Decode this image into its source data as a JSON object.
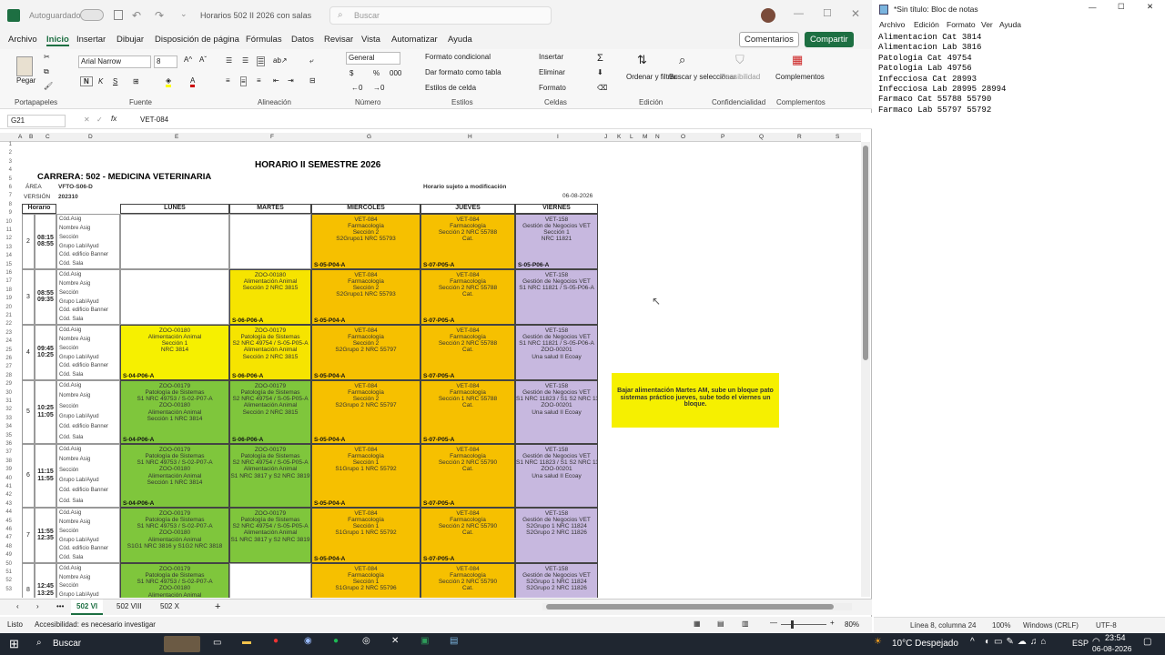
{
  "excel": {
    "autosave_label": "Autoguardado",
    "doc_title": "Horarios 502 II 2026 con salas",
    "search_placeholder": "Buscar",
    "menu": [
      "Archivo",
      "Inicio",
      "Insertar",
      "Dibujar",
      "Disposición de página",
      "Fórmulas",
      "Datos",
      "Revisar",
      "Vista",
      "Automatizar",
      "Ayuda"
    ],
    "comments_btn": "Comentarios",
    "share_btn": "Compartir",
    "ribbon": {
      "paste": "Pegar",
      "font_name": "Arial Narrow",
      "font_size": "8",
      "number_format": "General",
      "cond_format": "Formato condicional",
      "table_format": "Dar formato como tabla",
      "cell_styles": "Estilos de celda",
      "insert": "Insertar",
      "delete": "Eliminar",
      "format": "Formato",
      "sort_filter": "Ordenar y filtrar",
      "find_select": "Buscar y seleccionar",
      "sensitivity": "Sensibilidad",
      "addins": "Complementos",
      "groups": [
        "Portapapeles",
        "Fuente",
        "Alineación",
        "Número",
        "Estilos",
        "Celdas",
        "Edición",
        "Confidencialidad",
        "Complementos"
      ]
    },
    "namebox": "G21",
    "formula": "VET-084",
    "columns": [
      "A",
      "B",
      "C",
      "D",
      "E",
      "F",
      "G",
      "H",
      "I",
      "J",
      "K",
      "L",
      "M",
      "N",
      "O",
      "P",
      "Q",
      "R",
      "S"
    ],
    "sheet": {
      "title": "HORARIO II SEMESTRE 2026",
      "carrera": "CARRERA: 502 - MEDICINA VETERINARIA",
      "area_label": "ÁREA",
      "area_value": "VFTO-S06-D",
      "version_label": "VERSIÓN",
      "version_value": "202310",
      "subject_note": "Horario sujeto a modificación",
      "date": "06-08-2026",
      "headers": [
        "Horario",
        "LUNES",
        "MARTES",
        "MIÉRCOLES",
        "JUEVES",
        "VIERNES"
      ],
      "row_labels": [
        "Cód.Asig",
        "Nombre Asig",
        "Sección",
        "Grupo Lab/Ayud",
        "Cód. edificio Banner",
        "Cód. Sala"
      ],
      "blocks": [
        {
          "n": "2",
          "time": "08:15\n08:55",
          "cells": [
            {
              "day": 3,
              "color": "#f6c000",
              "text": "VET-084\nFarmacología\nSección 2\nS2Grupo1 NRC 55793",
              "room": "S-05-P04-A"
            },
            {
              "day": 4,
              "color": "#f6c000",
              "text": "VET-084\nFarmacología\nSección 2 NRC 55788\nCat.",
              "room": "S-07-P05-A"
            },
            {
              "day": 5,
              "color": "#c7b8df",
              "text": "VET-158\nGestión de Negocios VET\nSección 1\nNRC 11821",
              "room": "S-05-P06-A"
            }
          ]
        },
        {
          "n": "3",
          "time": "08:55\n09:35",
          "cells": [
            {
              "day": 2,
              "color": "#f6e400",
              "text": "ZOO-00180\nAlimentación Animal\nSección 2 NRC 3815",
              "room": "S-06-P06-A"
            },
            {
              "day": 3,
              "color": "#f6c000",
              "text": "VET-084\nFarmacología\nSección 2\nS2Grupo1 NRC 55793",
              "room": "S-05-P04-A"
            },
            {
              "day": 4,
              "color": "#f6c000",
              "text": "VET-084\nFarmacología\nSección 2 NRC 55788\nCat.",
              "room": "S-07-P05-A"
            },
            {
              "day": 5,
              "color": "#c7b8df",
              "text": "VET-158\nGestión de Negocios VET\nS1 NRC 11821 / S-05-P06-A",
              "room": ""
            }
          ]
        },
        {
          "n": "4",
          "time": "09:45\n10:25",
          "cells": [
            {
              "day": 1,
              "color": "#f6f000",
              "text": "ZOO-00180\nAlimentación Animal\nSección 1\nNRC 3814",
              "room": "S-04-P06-A"
            },
            {
              "day": 2,
              "color": "#f6e400",
              "text": "ZOO-00179\nPatología de Sistemas\nS2 NRC 49754 / S-05-P05-A\nAlimentación Animal\nSección 2 NRC 3815",
              "room": "S-06-P06-A"
            },
            {
              "day": 3,
              "color": "#f6c000",
              "text": "VET-084\nFarmacología\nSección 2\nS2Grupo 2 NRC 55797",
              "room": "S-05-P04-A"
            },
            {
              "day": 4,
              "color": "#f6c000",
              "text": "VET-084\nFarmacología\nSección 2 NRC 55788\nCat.",
              "room": "S-07-P05-A"
            },
            {
              "day": 5,
              "color": "#c7b8df",
              "text": "VET-158\nGestión de Negocios VET\nS1 NRC 11821 / S-05-P06-A\nZOO-00201\nUna salud II Ecoay",
              "room": ""
            }
          ]
        },
        {
          "n": "5",
          "time": "10:25\n11:05",
          "cells": [
            {
              "day": 1,
              "color": "#7fc63c",
              "text": "ZOO-00179\nPatología de Sistemas\nS1 NRC 49753 / S-02-P07-A\nZOO-00180\nAlimentación Animal\nSección 1 NRC 3814",
              "room": "S-04-P06-A"
            },
            {
              "day": 2,
              "color": "#7fc63c",
              "text": "ZOO-00179\nPatología de Sistemas\nS2 NRC 49754 / S-05-P05-A\nAlimentación Animal\nSección 2 NRC 3815",
              "room": "S-06-P06-A"
            },
            {
              "day": 3,
              "color": "#f6c000",
              "text": "VET-084\nFarmacología\nSección 2\nS2Grupo 2 NRC 55797",
              "room": "S-05-P04-A"
            },
            {
              "day": 4,
              "color": "#f6c000",
              "text": "VET-084\nFarmacología\nSección 1 NRC 55788\nCat.",
              "room": "S-07-P05-A"
            },
            {
              "day": 5,
              "color": "#c7b8df",
              "text": "VET-158\nGestión de Negocios VET\nS1 NRC 11823 / S1 S2 NRC 11825\nZOO-00201\nUna salud II Ecoay",
              "room": ""
            }
          ]
        },
        {
          "n": "6",
          "time": "11:15\n11:55",
          "cells": [
            {
              "day": 1,
              "color": "#7fc63c",
              "text": "ZOO-00179\nPatología de Sistemas\nS1 NRC 49753 / S-02-P07-A\nZOO-00180\nAlimentación Animal\nSección 1 NRC 3814",
              "room": "S-04-P06-A"
            },
            {
              "day": 2,
              "color": "#7fc63c",
              "text": "ZOO-00179\nPatología de Sistemas\nS2 NRC 49754 / S-05-P05-A\nAlimentación Animal\nS1 NRC 3817 y S2 NRC 3819",
              "room": ""
            },
            {
              "day": 3,
              "color": "#f6c000",
              "text": "VET-084\nFarmacología\nSección 1\nS1Grupo 1 NRC 55792",
              "room": "S-05-P04-A"
            },
            {
              "day": 4,
              "color": "#f6c000",
              "text": "VET-084\nFarmacología\nSección 2 NRC 55790\nCat.",
              "room": "S-07-P05-A"
            },
            {
              "day": 5,
              "color": "#c7b8df",
              "text": "VET-158\nGestión de Negocios VET\nS1 NRC 11823 / S1 S2 NRC 11825\nZOO-00201\nUna salud II Ecoay",
              "room": ""
            }
          ]
        },
        {
          "n": "7",
          "time": "11:55\n12:35",
          "cells": [
            {
              "day": 1,
              "color": "#7fc63c",
              "text": "ZOO-00179\nPatología de Sistemas\nS1 NRC 49753 / S-02-P07-A\nZOO-00180\nAlimentación Animal\nS1G1 NRC 3816 y S1G2 NRC 3818",
              "room": ""
            },
            {
              "day": 2,
              "color": "#7fc63c",
              "text": "ZOO-00179\nPatología de Sistemas\nS2 NRC 49754 / S-05-P05-A\nAlimentación Animal\nS1 NRC 3817 y S2 NRC 3819",
              "room": ""
            },
            {
              "day": 3,
              "color": "#f6c000",
              "text": "VET-084\nFarmacología\nSección 1\nS1Grupo 1 NRC 55792",
              "room": "S-05-P04-A"
            },
            {
              "day": 4,
              "color": "#f6c000",
              "text": "VET-084\nFarmacología\nSección 2 NRC 55790\nCat.",
              "room": "S-07-P05-A"
            },
            {
              "day": 5,
              "color": "#c7b8df",
              "text": "VET-158\nGestión de Negocios VET\nS2Grupo 1 NRC 11824\nS2Grupo 2 NRC 11826",
              "room": ""
            }
          ]
        },
        {
          "n": "8",
          "time": "12:45\n13:25",
          "cells": [
            {
              "day": 1,
              "color": "#7fc63c",
              "text": "ZOO-00179\nPatología de Sistemas\nS1 NRC 49753 / S-02-P07-A\nZOO-00180\nAlimentación Animal",
              "room": ""
            },
            {
              "day": 3,
              "color": "#f6c000",
              "text": "VET-084\nFarmacología\nSección 1\nS1Grupo 2 NRC 55796",
              "room": ""
            },
            {
              "day": 4,
              "color": "#f6c000",
              "text": "VET-084\nFarmacología\nSección 2 NRC 55790\nCat.",
              "room": ""
            },
            {
              "day": 5,
              "color": "#c7b8df",
              "text": "VET-158\nGestión de Negocios VET\nS2Grupo 1 NRC 11824\nS2Grupo 2 NRC 11826",
              "room": ""
            }
          ]
        }
      ],
      "note": "Bajar alimentación Martes AM, sube un bloque pato sistemas práctico jueves, sube todo el viernes un bloque."
    },
    "tabs": [
      "502 VI",
      "502 VIII",
      "502 X"
    ],
    "status_left": "Listo",
    "accessibility": "Accesibilidad: es necesario investigar",
    "zoom": "80%"
  },
  "notepad": {
    "title": "*Sin título: Bloc de notas",
    "menu": [
      "Archivo",
      "Edición",
      "Formato",
      "Ver",
      "Ayuda"
    ],
    "content": "Alimentacion Cat 3814\nAlimentacion Lab 3816\nPatologia Cat 49754\nPatologia Lab 49756\nInfecciosa Cat 28993\nInfecciosa Lab 28995 28994\nFarmaco Cat 55788 55790\nFarmaco Lab 55797 55792",
    "status": {
      "pos": "Línea 8, columna 24",
      "zoom": "100%",
      "eol": "Windows (CRLF)",
      "enc": "UTF-8"
    }
  },
  "taskbar": {
    "search": "Buscar",
    "weather": "10°C Despejado",
    "lang": "ESP",
    "time": "23:54",
    "date": "06-08-2026"
  }
}
